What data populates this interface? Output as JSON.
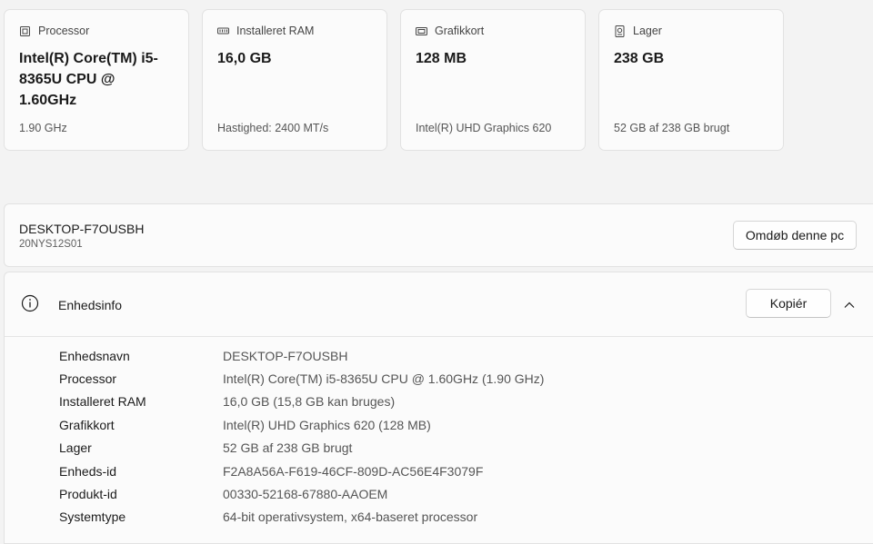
{
  "cards": [
    {
      "icon": "processor-icon",
      "title": "Processor",
      "value": "Intel(R) Core(TM) i5-8365U CPU @ 1.60GHz",
      "sub": "1.90 GHz"
    },
    {
      "icon": "ram-icon",
      "title": "Installeret RAM",
      "value": "16,0 GB",
      "sub": "Hastighed: 2400 MT/s"
    },
    {
      "icon": "graphics-card-icon",
      "title": "Grafikkort",
      "value": "128 MB",
      "sub": "Intel(R) UHD Graphics 620"
    },
    {
      "icon": "storage-icon",
      "title": "Lager",
      "value": "238 GB",
      "sub": "52 GB af 238 GB brugt"
    }
  ],
  "pc": {
    "name": "DESKTOP-F7OUSBH",
    "model": "20NYS12S01",
    "rename_label": "Omdøb denne pc"
  },
  "device_info": {
    "title": "Enhedsinfo",
    "copy_label": "Kopiér",
    "icon": "info-icon",
    "rows": [
      {
        "label": "Enhedsnavn",
        "value": "DESKTOP-F7OUSBH"
      },
      {
        "label": "Processor",
        "value": "Intel(R) Core(TM) i5-8365U CPU @ 1.60GHz (1.90 GHz)"
      },
      {
        "label": "Installeret RAM",
        "value": "16,0 GB (15,8 GB kan bruges)"
      },
      {
        "label": "Grafikkort",
        "value": "Intel(R) UHD Graphics 620 (128 MB)"
      },
      {
        "label": "Lager",
        "value": "52 GB af 238 GB brugt"
      },
      {
        "label": "Enheds-id",
        "value": "F2A8A56A-F619-46CF-809D-AC56E4F3079F"
      },
      {
        "label": "Produkt-id",
        "value": "00330-52168-67880-AAOEM"
      },
      {
        "label": "Systemtype",
        "value": "64-bit operativsystem, x64-baseret processor"
      }
    ]
  }
}
